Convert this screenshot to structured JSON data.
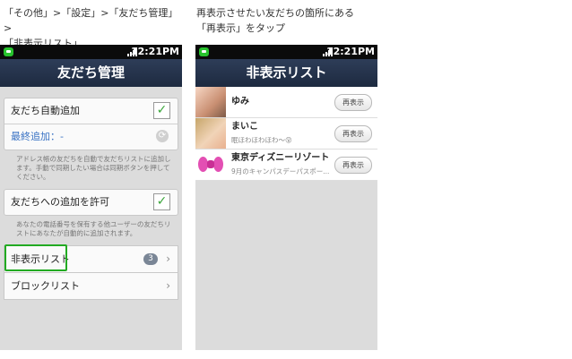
{
  "captions": {
    "left_line1": "「その他」>「設定」>「友だち管理」>",
    "left_line2": "「非表示リスト」",
    "right_line1": "再表示させたい友だちの箇所にある",
    "right_line2": "「再表示」をタップ"
  },
  "status_bar": {
    "time": "12:21PM"
  },
  "left_screen": {
    "title": "友だち管理",
    "auto_add_label": "友だち自動追加",
    "auto_add_checked": true,
    "last_added_label": "最終追加：-",
    "auto_add_note": "アドレス帳の友だちを自動で友だちリストに追加します。手動で同期したい場合は同期ボタンを押してください。",
    "allow_add_label": "友だちへの追加を許可",
    "allow_add_checked": true,
    "allow_add_note": "あなたの電話番号を保有する他ユーザーの友だちリストにあなたが自動的に追加されます。",
    "hidden_list_label": "非表示リスト",
    "hidden_list_count": "3",
    "block_list_label": "ブロックリスト"
  },
  "right_screen": {
    "title": "非表示リスト",
    "reshow_label": "再表示",
    "friends": [
      {
        "name": "ゆみ",
        "status": ""
      },
      {
        "name": "まいこ",
        "status": "眠ほわほわほわ～😲"
      },
      {
        "name": "東京ディズニーリゾート",
        "status": "9月のキャンパスデーパスポー..."
      }
    ]
  },
  "colors": {
    "highlight": "#22aa22",
    "titlebar": "#24324b",
    "link_blue": "#3a73c4"
  }
}
